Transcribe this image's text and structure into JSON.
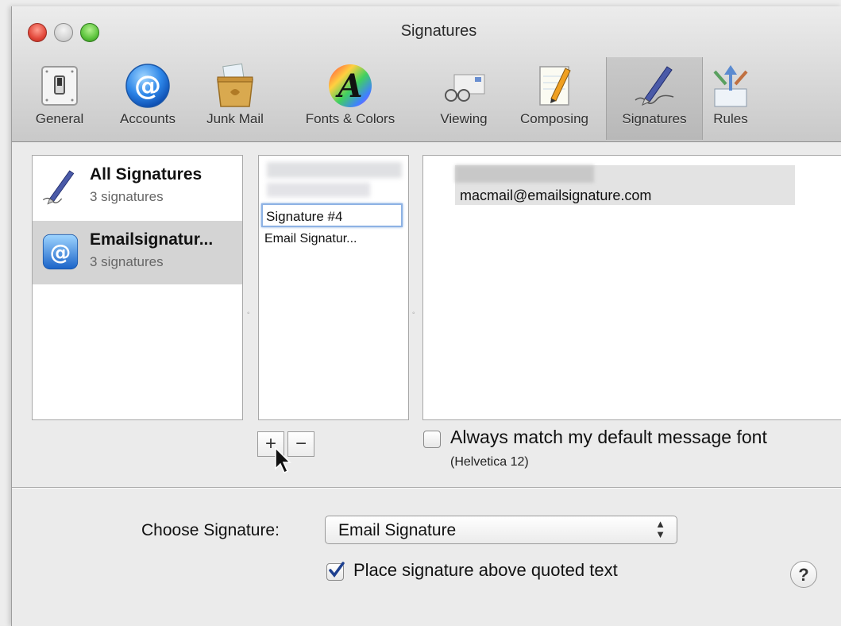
{
  "window": {
    "title": "Signatures"
  },
  "toolbar": {
    "items": [
      {
        "label": "General",
        "icon": "switch-icon"
      },
      {
        "label": "Accounts",
        "icon": "at-sign-icon"
      },
      {
        "label": "Junk Mail",
        "icon": "trash-bin-icon"
      },
      {
        "label": "Fonts & Colors",
        "icon": "font-color-icon"
      },
      {
        "label": "Viewing",
        "icon": "glasses-icon"
      },
      {
        "label": "Composing",
        "icon": "notepad-pencil-icon"
      },
      {
        "label": "Signatures",
        "icon": "pen-icon",
        "selected": true
      },
      {
        "label": "Rules",
        "icon": "arrows-icon"
      }
    ]
  },
  "accounts": {
    "items": [
      {
        "name": "All Signatures",
        "count": "3 signatures",
        "icon": "pen-icon",
        "selected": false
      },
      {
        "name": "Emailsignatur...",
        "count": "3 signatures",
        "icon": "at-sign-icon",
        "selected": true
      }
    ]
  },
  "signatures": {
    "editing_value": "Signature #4",
    "items": [
      {
        "label": "Email Signatur..."
      }
    ]
  },
  "editor": {
    "email": "macmail@emailsignature.com"
  },
  "controls": {
    "add_label": "+",
    "remove_label": "−",
    "match_font_label": "Always match my default message font",
    "match_font_sub": "(Helvetica 12)",
    "match_font_checked": false,
    "choose_label": "Choose Signature:",
    "choose_value": "Email Signature",
    "place_above_label": "Place signature above quoted text",
    "place_above_checked": true,
    "help_label": "?"
  }
}
